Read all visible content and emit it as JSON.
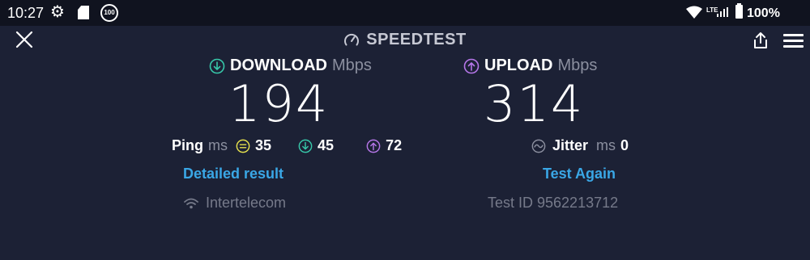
{
  "status_bar": {
    "time": "10:27",
    "battery_saver_badge": "100",
    "network": "LTE",
    "battery_percent": "100%",
    "icons": [
      "gear-icon",
      "sd-card-icon",
      "battery-saver-icon",
      "wifi-icon",
      "signal-icon",
      "battery-icon"
    ]
  },
  "app_bar": {
    "title": "SPEEDTEST",
    "icons": [
      "close-icon",
      "speedometer-icon",
      "share-icon",
      "menu-icon"
    ]
  },
  "download": {
    "label": "DOWNLOAD",
    "unit": "Mbps",
    "value": "194",
    "icon": "arrow-down-circle-icon",
    "color": "#37c7a9"
  },
  "upload": {
    "label": "UPLOAD",
    "unit": "Mbps",
    "value": "314",
    "icon": "arrow-up-circle-icon",
    "color": "#b576e8"
  },
  "ping": {
    "label": "Ping",
    "unit": "ms",
    "idle": "35",
    "download": "45",
    "upload": "72",
    "idle_color": "#e7e24d"
  },
  "jitter": {
    "label": "Jitter",
    "unit": "ms",
    "value": "0"
  },
  "actions": {
    "detailed_result": "Detailed result",
    "test_again": "Test Again"
  },
  "provider": {
    "name": "Intertelecom",
    "icon": "wifi-icon"
  },
  "test": {
    "id_text": "Test ID 9562213712"
  }
}
